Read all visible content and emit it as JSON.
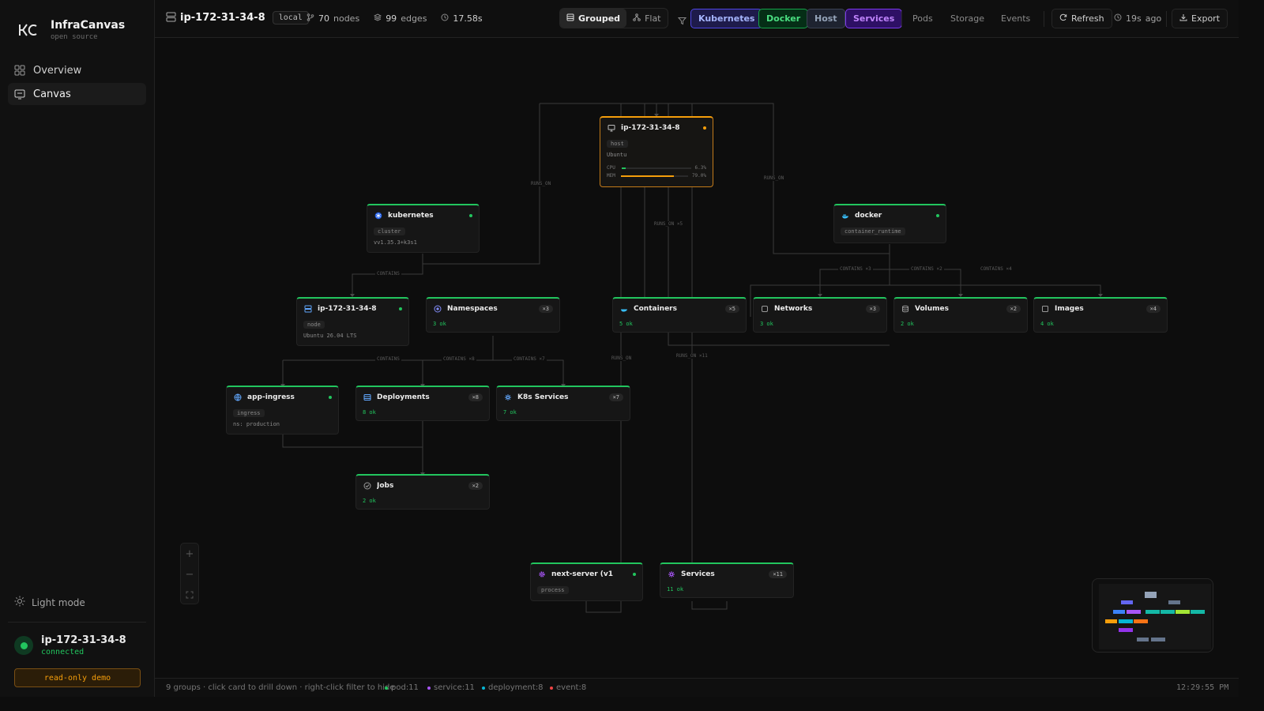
{
  "app": {
    "name": "InfraCanvas",
    "subtitle": "open source"
  },
  "sidebar": {
    "nav": [
      {
        "label": "Overview"
      },
      {
        "label": "Canvas"
      }
    ],
    "light_mode": "Light mode",
    "connection": {
      "host": "ip-172-31-34-8",
      "status": "connected"
    },
    "readonly_badge": "read-only demo"
  },
  "topbar": {
    "host": "ip-172-31-34-8",
    "env": "local",
    "nodes_count": "70",
    "nodes_label": "nodes",
    "edges_count": "99",
    "edges_label": "edges",
    "duration": "17.58s",
    "view_modes": [
      {
        "label": "Grouped",
        "active": true
      },
      {
        "label": "Flat",
        "active": false
      }
    ],
    "filters": [
      {
        "label": "Kubernetes",
        "color": "#6366f1"
      },
      {
        "label": "Docker",
        "color": "#22c55e"
      },
      {
        "label": "Host",
        "color": "#64748b"
      },
      {
        "label": "Services",
        "color": "#a855f7"
      }
    ],
    "links": [
      "Pods",
      "Storage",
      "Events"
    ],
    "refresh": "Refresh",
    "updated": "19s",
    "updated_suffix": "ago",
    "export": "Export"
  },
  "canvas": {
    "nodes": {
      "host": {
        "title": "ip-172-31-34-8",
        "tag": "host",
        "sub": "Ubuntu",
        "cpu_label": "CPU",
        "cpu_value": "6.3%",
        "cpu_pct": 6.3,
        "mem_label": "MEM",
        "mem_value": "79.0%",
        "mem_pct": 79.0
      },
      "kubernetes": {
        "title": "kubernetes",
        "tag": "cluster",
        "sub": "vv1.35.3+k3s1"
      },
      "docker": {
        "title": "docker",
        "tag": "container_runtime"
      },
      "k8s_node": {
        "title": "ip-172-31-34-8",
        "tag": "node",
        "sub": "Ubuntu 26.04 LTS"
      },
      "namespaces": {
        "title": "Namespaces",
        "count": "×3",
        "ok": "3 ok"
      },
      "containers": {
        "title": "Containers",
        "count": "×5",
        "ok": "5 ok"
      },
      "networks": {
        "title": "Networks",
        "count": "×3",
        "ok": "3 ok"
      },
      "volumes": {
        "title": "Volumes",
        "count": "×2",
        "ok": "2 ok"
      },
      "images": {
        "title": "Images",
        "count": "×4",
        "ok": "4 ok"
      },
      "ingress": {
        "title": "app-ingress",
        "tag": "ingress",
        "sub": "ns: production"
      },
      "deployments": {
        "title": "Deployments",
        "count": "×8",
        "ok": "8 ok"
      },
      "k8s_services": {
        "title": "K8s Services",
        "count": "×7",
        "ok": "7 ok"
      },
      "jobs": {
        "title": "Jobs",
        "count": "×2",
        "ok": "2 ok"
      },
      "process": {
        "title": "next-server (v1",
        "tag": "process"
      },
      "services": {
        "title": "Services",
        "count": "×11",
        "ok": "11 ok"
      }
    },
    "edge_labels": {
      "runs_on_1": "RUNS_ON",
      "runs_on_2": "RUNS_ON",
      "runs_on_3": "RUNS_ON ×5",
      "runs_on_4": "RUNS_ON",
      "runs_on_5": "RUNS_ON ×11",
      "contains_1": "CONTAINS",
      "contains_2": "CONTAINS",
      "contains_3": "CONTAINS ×8",
      "contains_4": "CONTAINS ×7",
      "contains_5": "CONTAINS ×3",
      "contains_6": "CONTAINS ×2",
      "contains_7": "CONTAINS ×4"
    }
  },
  "statusbar": {
    "hint": "9 groups · click card to drill down · right-click filter to hide",
    "legend": [
      {
        "label": "pod:11",
        "color": "#22c55e"
      },
      {
        "label": "service:11",
        "color": "#a855f7"
      },
      {
        "label": "deployment:8",
        "color": "#06b6d4"
      },
      {
        "label": "event:8",
        "color": "#ef4444"
      }
    ],
    "time": "12:29:55 PM"
  }
}
